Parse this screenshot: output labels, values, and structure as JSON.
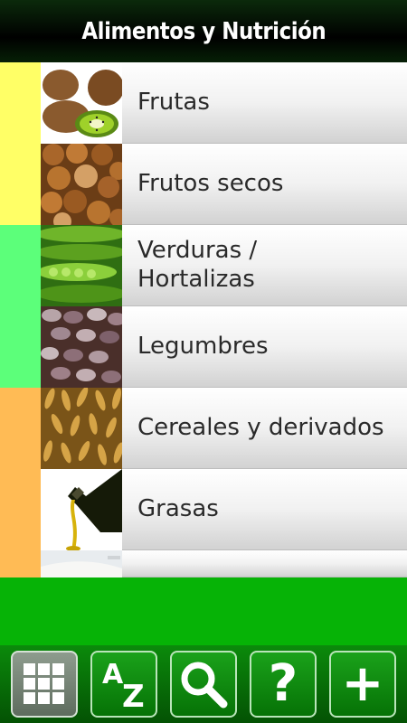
{
  "header": {
    "title": "Alimentos y Nutrición"
  },
  "categories": [
    {
      "label": "Frutas",
      "color": "#ffff66",
      "image": "kiwi"
    },
    {
      "label": "Frutos secos",
      "color": "#ffff66",
      "image": "hazelnuts"
    },
    {
      "label": "Verduras / Hortalizas",
      "label_line1": "Verduras /",
      "label_line2": "Hortalizas",
      "color": "#5cff7a",
      "image": "peas"
    },
    {
      "label": "Legumbres",
      "color": "#5cff7a",
      "image": "beans"
    },
    {
      "label": "Cereales y derivados",
      "color": "#ffbb55",
      "image": "oats"
    },
    {
      "label": "Grasas",
      "color": "#ffbb55",
      "image": "olive-oil"
    }
  ],
  "toolbar": {
    "buttons": [
      {
        "icon": "grid-icon",
        "active": true
      },
      {
        "icon": "az-sort-icon",
        "label_a": "A",
        "label_z": "Z"
      },
      {
        "icon": "search-icon"
      },
      {
        "icon": "help-icon",
        "label": "?"
      },
      {
        "icon": "add-icon",
        "label": "+"
      }
    ]
  },
  "colors": {
    "band": "#06b306",
    "toolbar": "#0b8a0b"
  }
}
